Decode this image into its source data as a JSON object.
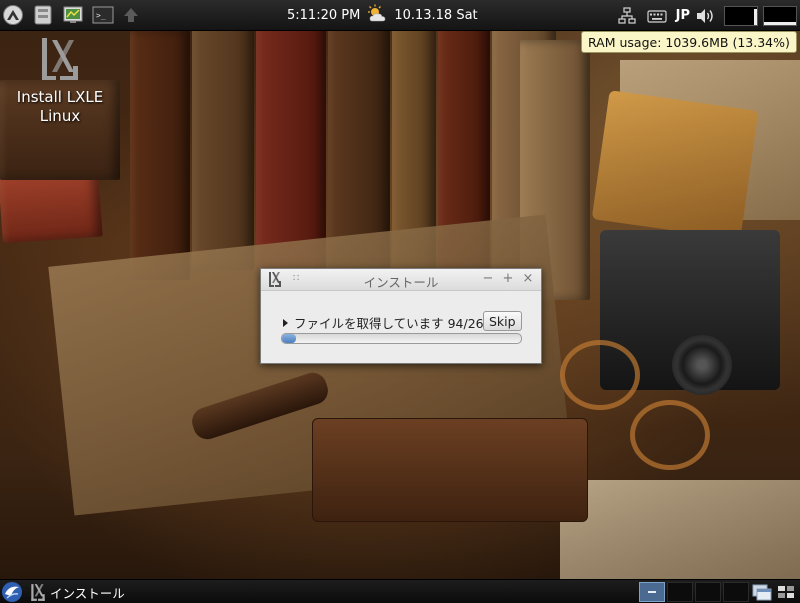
{
  "top_panel": {
    "clock": "5:11:20 PM",
    "date": "10.13.18 Sat",
    "keyboard_layout": "JP",
    "ram_tooltip": "RAM usage: 1039.6MB (13.34%)",
    "launchers": [
      "app-menu-icon",
      "file-manager-icon",
      "system-monitor-icon",
      "terminal-icon",
      "update-arrow-icon"
    ]
  },
  "desktop": {
    "icon_label": "Install LXLE Linux"
  },
  "dialog": {
    "title": "インストール",
    "status_text": "ファイルを取得しています 94/260",
    "skip_label": "Skip",
    "progress_percent": 6,
    "title_buttons": {
      "minimize": "−",
      "maximize": "+",
      "close": "×"
    }
  },
  "bottom_panel": {
    "task_label": "インストール",
    "workspaces": 4,
    "active_workspace": 1,
    "accent_color": "#4a6a92"
  }
}
